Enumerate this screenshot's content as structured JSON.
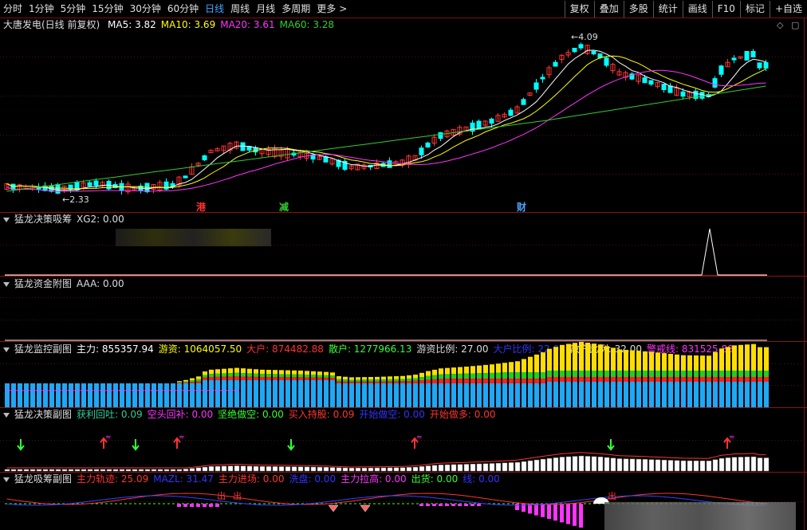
{
  "toolbar": {
    "periods": [
      "分时",
      "1分钟",
      "5分钟",
      "15分钟",
      "30分钟",
      "60分钟",
      "日线",
      "周线",
      "月线",
      "多周期",
      "更多"
    ],
    "active_period": "日线",
    "more_arrow": ">",
    "tools": [
      "复权",
      "叠加",
      "多股",
      "统计",
      "画线",
      "F10",
      "标记",
      "+自选"
    ]
  },
  "main_panel": {
    "title": "大唐发电(日线 前复权)",
    "ma": [
      {
        "label": "MA5: 3.82",
        "color": "#ffffff"
      },
      {
        "label": "MA10: 3.69",
        "color": "#ffff00"
      },
      {
        "label": "MA20: 3.61",
        "color": "#ff33ff"
      },
      {
        "label": "MA60: 3.28",
        "color": "#33cc33"
      }
    ],
    "high_label": "4.09",
    "low_label": "2.33",
    "markers": [
      {
        "text": "港",
        "color": "#ff3333"
      },
      {
        "text": "减",
        "color": "#33cc33"
      },
      {
        "text": "财",
        "color": "#4aa3ff"
      }
    ]
  },
  "panel_xg": {
    "name": "猛龙决策吸筹",
    "fields": [
      {
        "label": "XG2: 0.00",
        "color": "#dddddd"
      }
    ]
  },
  "panel_aaa": {
    "name": "猛龙资金附图",
    "fields": [
      {
        "label": "AAA: 0.00",
        "color": "#dddddd"
      }
    ]
  },
  "panel_monitor": {
    "name": "猛龙监控副图",
    "fields": [
      {
        "label": "主力: 855357.94",
        "color": "#ffffff"
      },
      {
        "label": "游资: 1064057.50",
        "color": "#ffff00"
      },
      {
        "label": "大户: 874482.88",
        "color": "#ff3333"
      },
      {
        "label": "散户: 1277966.13",
        "color": "#33ff33"
      },
      {
        "label": "游资比例: 27.00",
        "color": "#dddddd"
      },
      {
        "label": "大户比例: 22.00",
        "color": "#3333ff"
      },
      {
        "label": "散户比例: 32.00",
        "color": "#dddddd"
      },
      {
        "label": "警戒线: 831525.88",
        "color": "#ff33ff"
      }
    ]
  },
  "panel_decision": {
    "name": "猛龙决策副图",
    "fields": [
      {
        "label": "获利回吐: 0.09",
        "color": "#33cc99"
      },
      {
        "label": "空头回补: 0.00",
        "color": "#ff33ff"
      },
      {
        "label": "坚绝做空: 0.00",
        "color": "#33ff33"
      },
      {
        "label": "买入持股: 0.09",
        "color": "#ff3333"
      },
      {
        "label": "开始做空: 0.00",
        "color": "#3333ff"
      },
      {
        "label": "开始做多: 0.00",
        "color": "#ff3333"
      }
    ]
  },
  "panel_absorb": {
    "name": "猛龙吸筹副图",
    "fields": [
      {
        "label": "主力轨迹: 25.09",
        "color": "#ff3333"
      },
      {
        "label": "MAZL: 31.47",
        "color": "#3333ff"
      },
      {
        "label": "主力进场: 0.00",
        "color": "#ff3333"
      },
      {
        "label": "洗盘: 0.00",
        "color": "#3333ff"
      },
      {
        "label": "主力拉高: 0.00",
        "color": "#ff33ff"
      },
      {
        "label": "出货: 0.00",
        "color": "#33ff33"
      },
      {
        "label": "线: 0.00",
        "color": "#3333ff"
      }
    ],
    "out_labels": [
      "出",
      "出",
      "出"
    ]
  },
  "colors": {
    "up": "#ff3333",
    "down": "#00ffff",
    "grid": "#7a1010"
  }
}
